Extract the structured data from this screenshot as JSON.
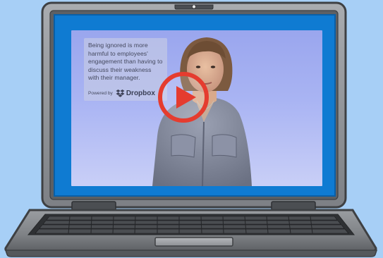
{
  "video": {
    "caption": "Being ignored is more harmful to employees' engagement than having to discuss their weakness with their manager.",
    "powered_by": "Powered by",
    "brand": "Dropbox",
    "play_icon": "play-icon",
    "brand_icon": "dropbox-icon"
  },
  "colors": {
    "background": "#a7cff6",
    "laptop_body": "#8a8d91",
    "play_red": "#e53c2f",
    "screen_blue": "#0f7bd2"
  }
}
